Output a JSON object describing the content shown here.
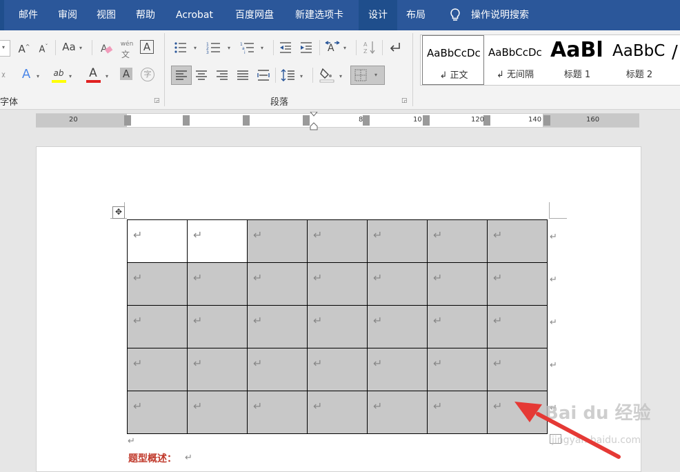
{
  "menu": {
    "tabs": [
      {
        "label": "邮件"
      },
      {
        "label": "审阅"
      },
      {
        "label": "视图"
      },
      {
        "label": "帮助"
      },
      {
        "label": "Acrobat"
      },
      {
        "label": "百度网盘"
      },
      {
        "label": "新建选项卡"
      },
      {
        "label": "设计"
      },
      {
        "label": "布局"
      }
    ],
    "search": "操作说明搜索",
    "active_tab": "设计"
  },
  "ribbon": {
    "font_group_label": "字体",
    "paragraph_group_label": "段落",
    "font_buttons": {
      "grow": "A",
      "shrink": "A",
      "case": "Aa",
      "phonetic": "wén",
      "charborder": "A",
      "texteffect": "A",
      "highlight": "ab",
      "fontcolor": "A",
      "shading": "A",
      "encircle": "字"
    },
    "styles": [
      {
        "sample": "AaBbCcDc",
        "name": "↲ 正文"
      },
      {
        "sample": "AaBbCcDc",
        "name": "↲ 无间隔"
      },
      {
        "sample": "AaBl",
        "name": "标题 1"
      },
      {
        "sample": "AaBbC",
        "name": "标题 2"
      }
    ]
  },
  "ruler": {
    "labels": [
      "20",
      "8",
      "10",
      "120",
      "140",
      "160"
    ]
  },
  "document": {
    "table": {
      "rows": 5,
      "cols": 7,
      "cell_mark": "↵",
      "unselected_cells": [
        [
          0,
          0
        ],
        [
          0,
          1
        ]
      ]
    },
    "row_end_mark": "↵",
    "paragraph_mark": "↵",
    "heading_text": "题型概述：",
    "heading_mark": "↵"
  },
  "watermark": {
    "main": "Bai du 经验",
    "sub": "jingyan.baidu.com"
  },
  "colors": {
    "menubar": "#2b579a",
    "selection": "#c8c8c8",
    "annotation_arrow": "#e53935"
  }
}
